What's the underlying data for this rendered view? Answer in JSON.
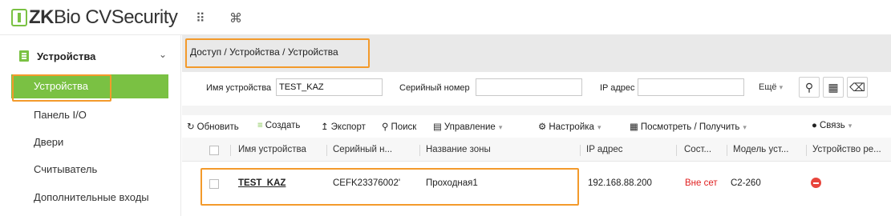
{
  "app": {
    "brand_zk": "ZK",
    "brand_bio": "Bio ",
    "brand_cv": "CVSecurity"
  },
  "topbar": {
    "apps_icon": "⠿",
    "cmd_icon": "⌘"
  },
  "sidebar": {
    "section_label": "Устройства",
    "items": [
      {
        "label": "Устройства",
        "active": true
      },
      {
        "label": "Панель I/O"
      },
      {
        "label": "Двери"
      },
      {
        "label": "Считыватель"
      },
      {
        "label": "Дополнительные входы"
      }
    ]
  },
  "breadcrumb": "Доступ / Устройства / Устройства",
  "filters": {
    "device_name_label": "Имя устройства",
    "device_name_value": "TEST_KAZ",
    "serial_label": "Серийный номер",
    "serial_value": "",
    "ip_label": "IP адрес",
    "ip_value": "",
    "more_label": "Ещё"
  },
  "toolbar": {
    "refresh": "Обновить",
    "create": "Создать",
    "export": "Экспорт",
    "search": "Поиск",
    "manage": "Управление",
    "settings": "Настройка",
    "view_get": "Посмотреть / Получить",
    "link": "Связь"
  },
  "table": {
    "columns": [
      "Имя устройства",
      "Серийный н...",
      "Название зоны",
      "IP адрес",
      "Сост...",
      "Модель уст...",
      "Устройство ре..."
    ],
    "rows": [
      {
        "name": "TEST_KAZ",
        "serial": "CEFK23376002'",
        "zone": "Проходная1",
        "ip": "192.168.88.200",
        "status": "Вне сет",
        "model": "C2-260"
      }
    ]
  },
  "colors": {
    "accent": "#7ac143",
    "highlight": "#f39a2b",
    "status_offline": "#e02020"
  }
}
